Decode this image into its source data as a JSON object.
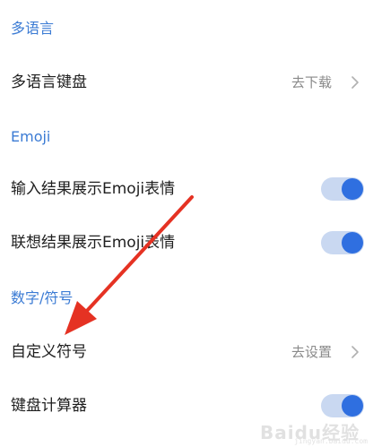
{
  "sections": [
    {
      "header": "多语言",
      "rows": [
        {
          "label": "多语言键盘",
          "value": "去下载",
          "control": "chevron"
        }
      ]
    },
    {
      "header": "Emoji",
      "rows": [
        {
          "label": "输入结果展示Emoji表情",
          "control": "toggle",
          "on": true
        },
        {
          "label": "联想结果展示Emoji表情",
          "control": "toggle",
          "on": true
        }
      ]
    },
    {
      "header": "数字/符号",
      "rows": [
        {
          "label": "自定义符号",
          "value": "去设置",
          "control": "chevron"
        },
        {
          "label": "键盘计算器",
          "control": "toggle",
          "on": true
        }
      ]
    }
  ],
  "colors": {
    "section_header": "#3b7bd4",
    "toggle_track": "#c9d8f1",
    "toggle_knob": "#2f6fe0",
    "annotation_arrow": "#e53223"
  },
  "watermark": {
    "text": "Baidu经验",
    "sub": "jingyan.baidu.com"
  }
}
